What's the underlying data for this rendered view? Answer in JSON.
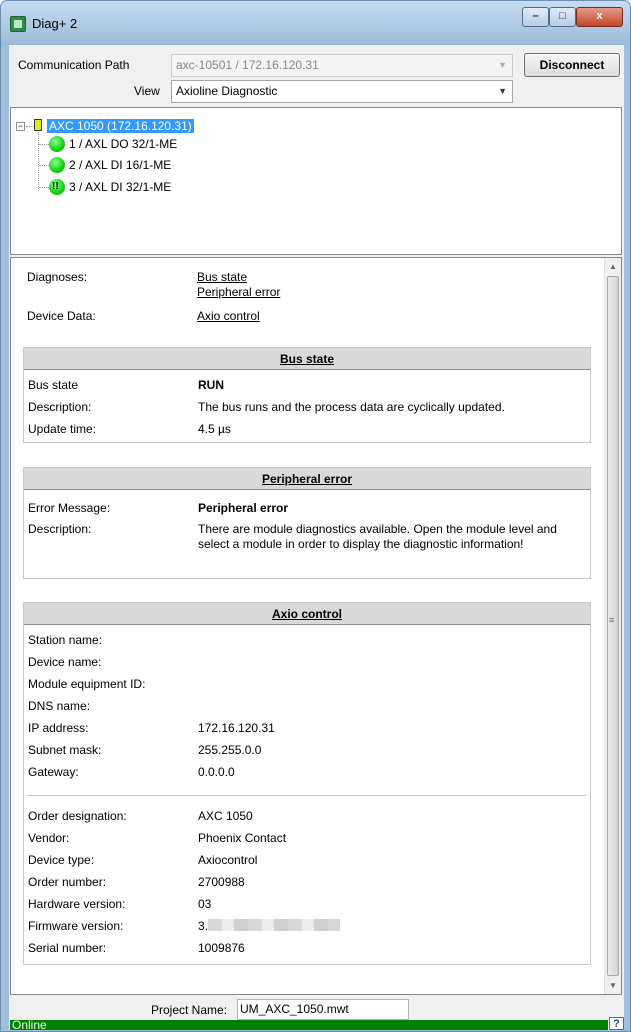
{
  "window": {
    "title": "Diag+ 2",
    "controls": {
      "minimize": "–",
      "maximize": "□",
      "close": "x"
    }
  },
  "connection": {
    "comm_path_label": "Communication Path",
    "comm_path_value": "axc-10501 / 172.16.120.31",
    "view_label": "View",
    "view_value": "Axioline Diagnostic",
    "disconnect_label": "Disconnect"
  },
  "tree": {
    "root": {
      "label": "AXC 1050 (172.16.120.31)",
      "expanded": true
    },
    "children": [
      {
        "label": "1 / AXL DO 32/1-ME",
        "status": "ok"
      },
      {
        "label": "2 / AXL DI 16/1-ME",
        "status": "ok"
      },
      {
        "label": "3 / AXL DI 32/1-ME",
        "status": "warning"
      }
    ]
  },
  "summary": {
    "diagnoses_label": "Diagnoses:",
    "diagnoses_links": [
      "Bus state",
      "Peripheral error"
    ],
    "device_data_label": "Device Data:",
    "device_data_link": "Axio control"
  },
  "bus_state": {
    "header": "Bus state",
    "rows": [
      {
        "key": "Bus state",
        "value": "RUN"
      },
      {
        "key": "Description:",
        "value": "The bus runs and the process data are cyclically updated."
      },
      {
        "key": "Update time:",
        "value": "4.5 µs"
      }
    ]
  },
  "peripheral_error": {
    "header": "Peripheral error",
    "rows": [
      {
        "key": "Error Message:",
        "value": "Peripheral error"
      },
      {
        "key": "Description:",
        "value": "There are module diagnostics available. Open the module level and select a module in order to display the diagnostic information!"
      }
    ]
  },
  "axio_control": {
    "header": "Axio control",
    "network": [
      {
        "key": "Station name:",
        "value": ""
      },
      {
        "key": "Device name:",
        "value": ""
      },
      {
        "key": "Module equipment ID:",
        "value": ""
      },
      {
        "key": "DNS name:",
        "value": ""
      },
      {
        "key": "IP address:",
        "value": "172.16.120.31"
      },
      {
        "key": "Subnet mask:",
        "value": "255.255.0.0"
      },
      {
        "key": "Gateway:",
        "value": "0.0.0.0"
      }
    ],
    "device": [
      {
        "key": "Order designation:",
        "value": "AXC 1050"
      },
      {
        "key": "Vendor:",
        "value": "Phoenix Contact"
      },
      {
        "key": "Device type:",
        "value": "Axiocontrol"
      },
      {
        "key": "Order number:",
        "value": "2700988"
      },
      {
        "key": "Hardware version:",
        "value": "03"
      },
      {
        "key": "Firmware version:",
        "value": "3."
      },
      {
        "key": "Serial number:",
        "value": "1009876"
      }
    ]
  },
  "project": {
    "label": "Project Name:",
    "value": "UM_AXC_1050.mwt"
  },
  "status": {
    "text": "Online",
    "help": "?",
    "color": "#008000"
  }
}
